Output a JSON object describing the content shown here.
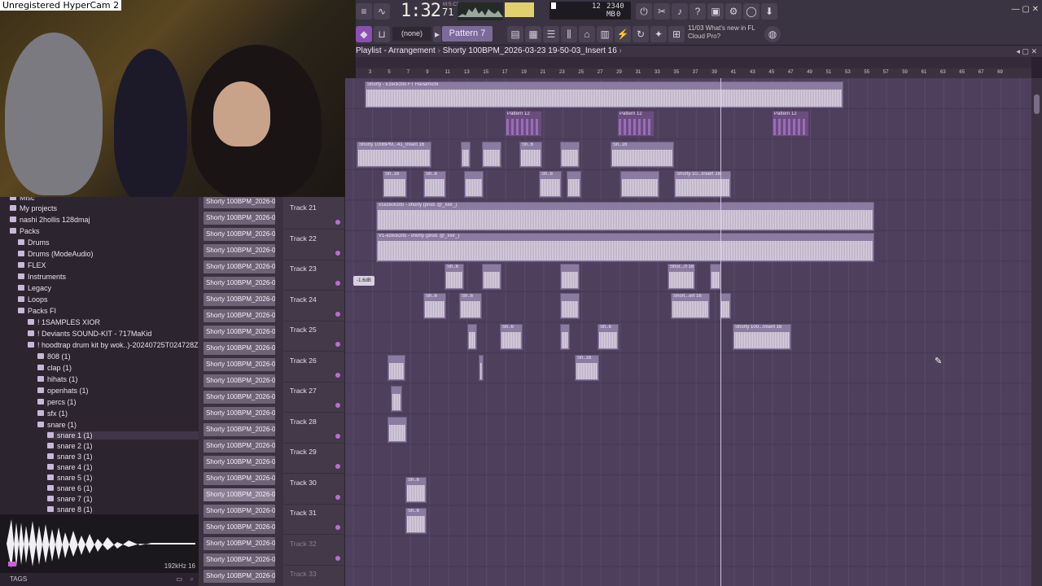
{
  "watermark": "Unregistered HyperCam 2",
  "toolbar": {
    "time": "1:32",
    "time_ms": "71",
    "time_label": "M:S:CS",
    "cpu_line1": "12",
    "cpu_line2": "2340 MB",
    "cpu_line3": "0",
    "snap": "(none)",
    "pattern": "Pattern 7",
    "news_line1": "11/03  What's new in FL",
    "news_line2": "Cloud Pro?"
  },
  "playlist": {
    "title": "Playlist - Arrangement",
    "sep": "›",
    "name": "Shorty 100BPM_2026-03-23 19-50-03_Insert 16",
    "sep2": "›"
  },
  "browser": {
    "items": [
      {
        "label": "Misc"
      },
      {
        "label": "My projects"
      },
      {
        "label": "nashi 2hollis 128dmaj"
      },
      {
        "label": "Packs"
      },
      {
        "label": "Drums"
      },
      {
        "label": "Drums (ModeAudio)"
      },
      {
        "label": "FLEX"
      },
      {
        "label": "Instruments"
      },
      {
        "label": "Legacy"
      },
      {
        "label": "Loops"
      },
      {
        "label": "Packs FI"
      },
      {
        "label": "! 1SAMPLES XIOR"
      },
      {
        "label": "! Deviants SOUND-KIT - 717MaKid"
      },
      {
        "label": "! hoodtrap drum kit by wok..)-20240725T024728Z-001"
      },
      {
        "label": "808 (1)"
      },
      {
        "label": "clap (1)"
      },
      {
        "label": "hihats (1)"
      },
      {
        "label": "openhats (1)"
      },
      {
        "label": "percs (1)"
      },
      {
        "label": "sfx (1)"
      },
      {
        "label": "snare (1)"
      },
      {
        "label": "snare 1 (1)"
      },
      {
        "label": "snare 2 (1)"
      },
      {
        "label": "snare 3 (1)"
      },
      {
        "label": "snare 4 (1)"
      },
      {
        "label": "snare 5 (1)"
      },
      {
        "label": "snare 6 (1)"
      },
      {
        "label": "snare 7 (1)"
      },
      {
        "label": "snare 8 (1)"
      }
    ],
    "preview_info": "192kHz 16",
    "tags": "TAGS"
  },
  "clips_list": {
    "label": "Shorty 100BPM_2026-03..."
  },
  "tracks": [
    {
      "name": "Track 21"
    },
    {
      "name": "Track 22"
    },
    {
      "name": "Track 23"
    },
    {
      "name": "Track 24"
    },
    {
      "name": "Track 25"
    },
    {
      "name": "Track 26"
    },
    {
      "name": "Track 27"
    },
    {
      "name": "Track 28"
    },
    {
      "name": "Track 29"
    },
    {
      "name": "Track 30"
    },
    {
      "name": "Track 31"
    },
    {
      "name": "Track 32"
    },
    {
      "name": "Track 33"
    }
  ],
  "ruler": [
    "3",
    "5",
    "7",
    "9",
    "11",
    "13",
    "15",
    "17",
    "19",
    "21",
    "23",
    "25",
    "27",
    "29",
    "31",
    "33",
    "35",
    "37",
    "39",
    "41",
    "43",
    "45",
    "47",
    "49",
    "51",
    "53",
    "55",
    "57",
    "59",
    "61",
    "63",
    "65",
    "67",
    "69"
  ],
  "clip_titles": {
    "top": "Shorty - Ezeckzito FT Hanamichi",
    "pattern12": "Pattern 12",
    "insert16": "Shorty 100BPM...41_Insert 16",
    "sh16": "Sh..16",
    "sh6": "Sh..6",
    "ezezeckzito": "v1ezeckzito - shorty (prod. @_xior_)",
    "v1": "V1-ezeckzito - shorty (prod. @_xior_)",
    "shorty_100": "Shorty 100...Insert 16",
    "shorty16": "Shorty 10...Insert 16",
    "short_ert16": "Short...ert 16",
    "shor_rt16": "Shor...rt 16",
    "v1short": "V1...",
    "vol": "-1.6dB"
  }
}
